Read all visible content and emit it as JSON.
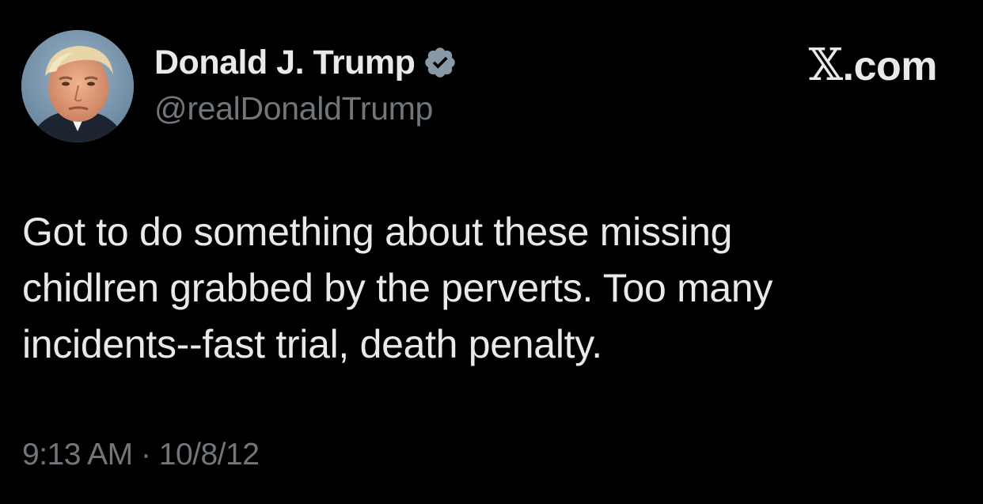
{
  "author": {
    "display_name": "Donald J. Trump",
    "handle": "@realDonaldTrump",
    "verified": true,
    "verified_badge_color": "#8899a6",
    "avatar_icon": "profile-photo"
  },
  "brand": {
    "x_glyph": "𝕏",
    "suffix": ".com"
  },
  "tweet": {
    "text": "Got to do something about these missing\nchidlren grabbed by the perverts. Too many\nincidents--fast trial, death penalty.",
    "time": "9:13 AM",
    "separator": "·",
    "date": "10/8/12"
  },
  "colors": {
    "background": "#000000",
    "primary_text": "#e7e9ea",
    "secondary_text": "#71767b"
  }
}
